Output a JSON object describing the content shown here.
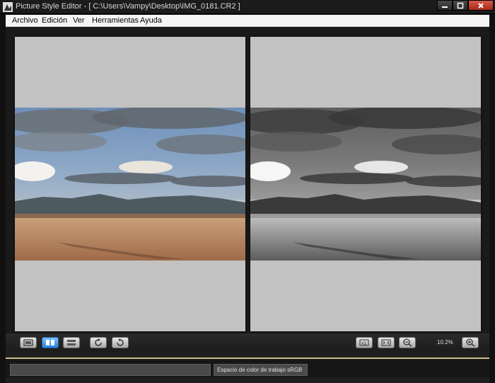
{
  "window": {
    "title": "Picture Style Editor - [ C:\\Users\\Vampy\\Desktop\\IMG_0181.CR2 ]"
  },
  "menu": [
    {
      "label": "Archivo"
    },
    {
      "label": "Edición"
    },
    {
      "label": "Ver"
    },
    {
      "label": "Herramientas"
    },
    {
      "label": "Ayuda"
    }
  ],
  "toolbar": {
    "zoom_label": "10.2%",
    "active_view": "side-by-side"
  },
  "status": {
    "left_text": "",
    "color_space": "Espacio de color de trabajo sRGB"
  }
}
